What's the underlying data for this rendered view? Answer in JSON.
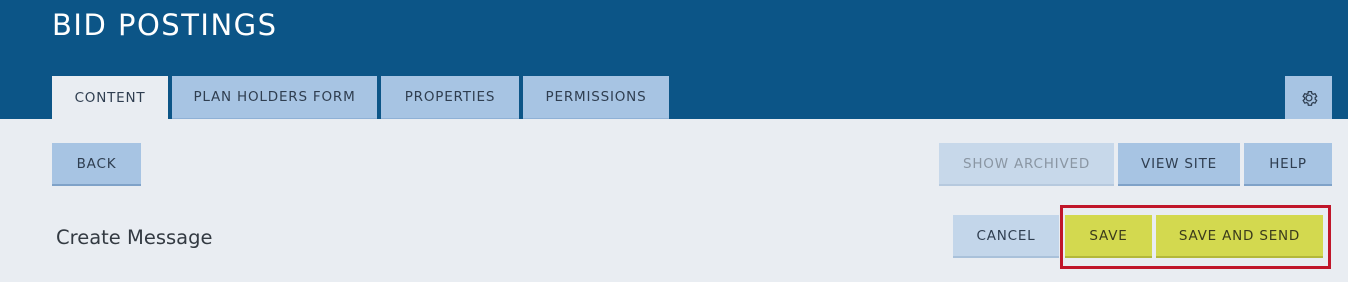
{
  "header": {
    "title": "BID POSTINGS"
  },
  "tabs": [
    {
      "label": "CONTENT",
      "active": true
    },
    {
      "label": "PLAN HOLDERS FORM",
      "active": false
    },
    {
      "label": "PROPERTIES",
      "active": false
    },
    {
      "label": "PERMISSIONS",
      "active": false
    }
  ],
  "settings": {
    "icon": "gear-icon"
  },
  "toolbar": {
    "back_label": "BACK",
    "show_archived_label": "SHOW ARCHIVED",
    "view_site_label": "VIEW SITE",
    "help_label": "HELP"
  },
  "form": {
    "title": "Create Message",
    "cancel_label": "CANCEL",
    "save_label": "SAVE",
    "save_and_send_label": "SAVE AND SEND"
  },
  "colors": {
    "header_bg": "#0c5587",
    "tab_bg": "#a7c4e3",
    "page_bg": "#e9edf2",
    "save_bg": "#d3d94f",
    "highlight": "#c0162a"
  }
}
